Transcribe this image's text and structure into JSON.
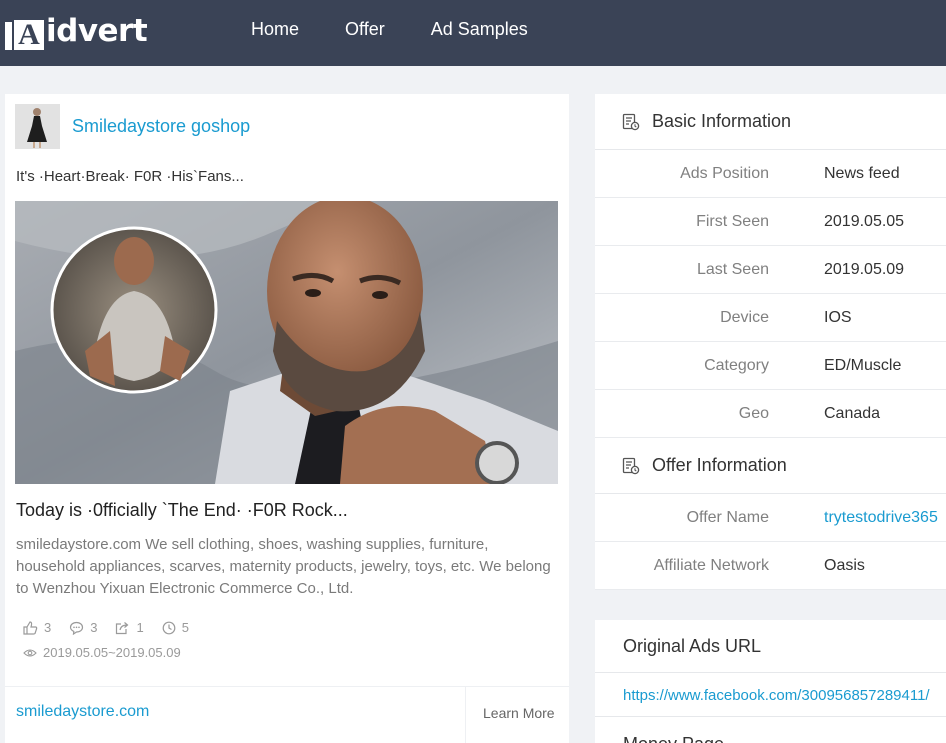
{
  "header": {
    "logo_text": "idvert",
    "logo_letter": "A",
    "nav": [
      "Home",
      "Offer",
      "Ad Samples"
    ]
  },
  "ad": {
    "advertiser": "Smiledaystore goshop",
    "caption": "It's ·Heart·Break· F0R ·His`Fans...",
    "headline": "Today is ·0fficially `The End· ·F0R Rock...",
    "body": "smiledaystore.com We sell clothing, shoes, washing supplies, furniture, household appliances, scarves, maternity products, jewelry, toys, etc. We belong to Wenzhou Yixuan Electronic Commerce Co., Ltd.",
    "stats": {
      "likes": "3",
      "comments": "3",
      "shares": "1",
      "days": "5"
    },
    "date_range": "2019.05.05~2019.05.09",
    "domain": "smiledaystore.com",
    "cta": "Learn More"
  },
  "basic_info": {
    "title": "Basic Information",
    "rows": [
      {
        "label": "Ads Position",
        "value": "News feed"
      },
      {
        "label": "First Seen",
        "value": "2019.05.05"
      },
      {
        "label": "Last Seen",
        "value": "2019.05.09"
      },
      {
        "label": "Device",
        "value": "IOS"
      },
      {
        "label": "Category",
        "value": "ED/Muscle"
      },
      {
        "label": "Geo",
        "value": "Canada"
      }
    ]
  },
  "offer_info": {
    "title": "Offer Information",
    "rows": [
      {
        "label": "Offer Name",
        "value": "trytestodrive365"
      },
      {
        "label": "Affiliate Network",
        "value": "Oasis"
      }
    ]
  },
  "original_url": {
    "title": "Original Ads URL",
    "value": "https://www.facebook.com/300956857289411/"
  },
  "money_page": {
    "title": "Money Page"
  },
  "colors": {
    "header_bg": "#3a4356",
    "accent": "#1a9bd0",
    "page_bg": "#f0f2f5"
  }
}
